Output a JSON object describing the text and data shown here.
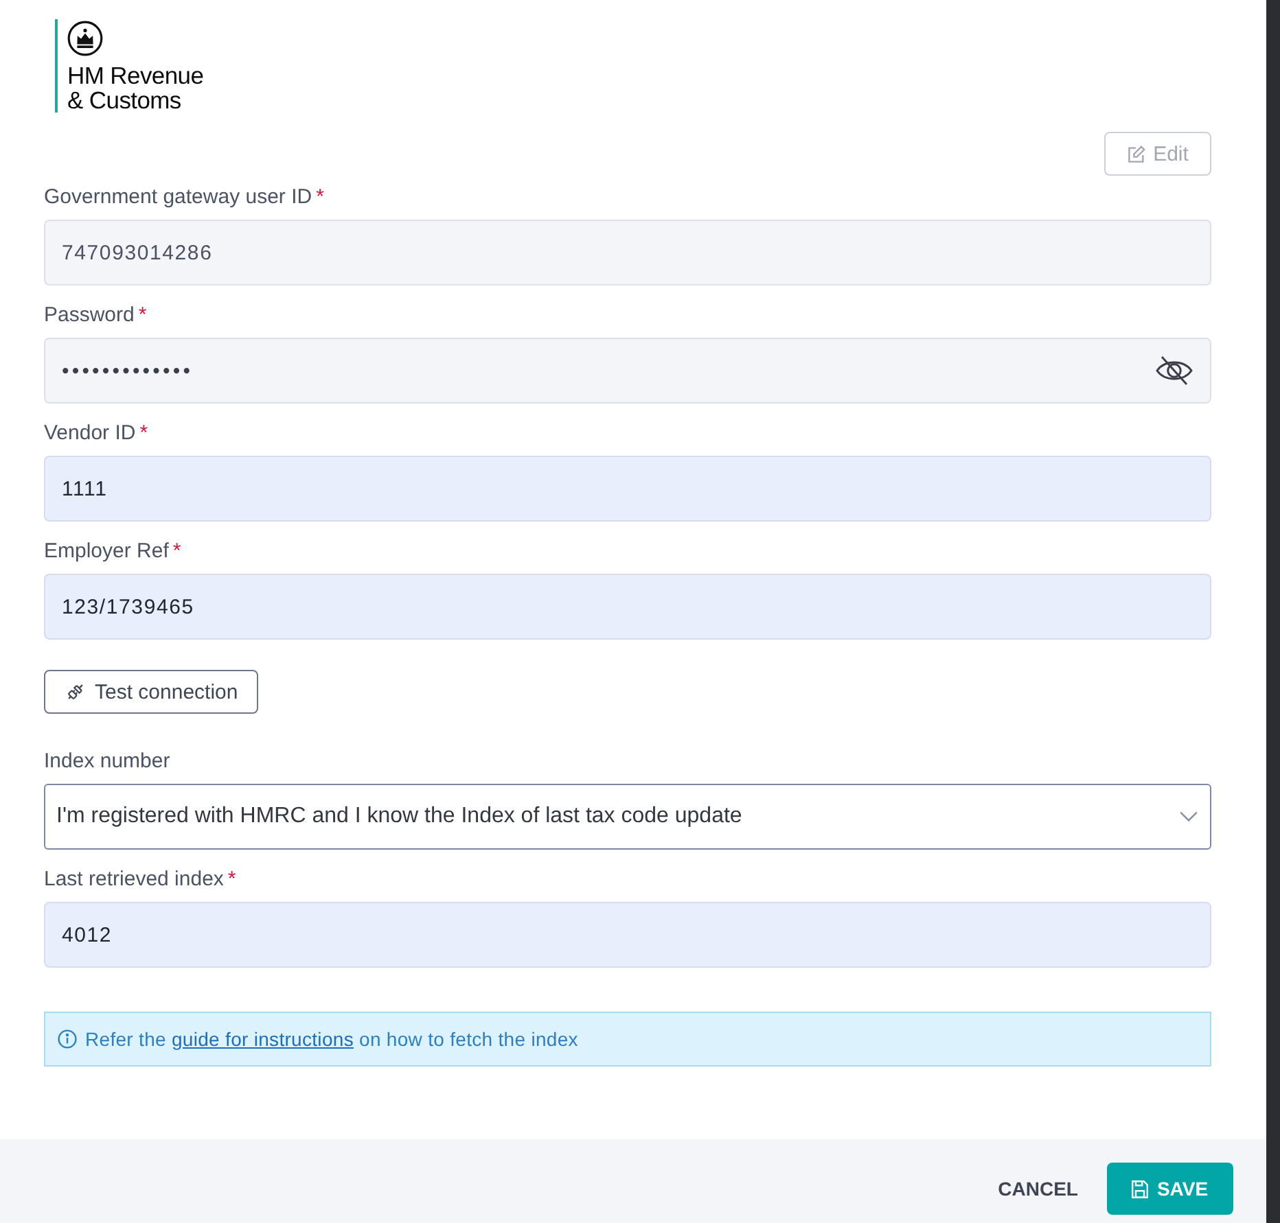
{
  "logo": {
    "lines": [
      "HM Revenue",
      "& Customs"
    ]
  },
  "edit_button": {
    "label": "Edit",
    "disabled": true
  },
  "items": [
    {
      "kind": "text",
      "label": "Government gateway user ID",
      "required_mark": "*",
      "value": "747093014286",
      "autofilled": false
    },
    {
      "kind": "password",
      "label": "Password",
      "required_mark": "*",
      "value": "•••••••••••••",
      "autofilled": false
    },
    {
      "kind": "text",
      "label": "Vendor ID",
      "required_mark": "*",
      "value": "1111",
      "autofilled": true
    },
    {
      "kind": "text",
      "label": "Employer Ref",
      "required_mark": "*",
      "value": "123/1739465",
      "autofilled": true
    },
    {
      "kind": "button",
      "label": "Test connection"
    },
    {
      "kind": "select",
      "label": "Index number",
      "value": "I'm registered with HMRC and I know the Index of last tax code update"
    },
    {
      "kind": "text",
      "label": "Last retrieved index",
      "required_mark": "*",
      "value": "4012",
      "autofilled": true
    }
  ],
  "info_alert": {
    "text_before": "Refer the",
    "link": "guide for instructions",
    "text_after": "on how to fetch the index"
  },
  "footer": {
    "cancel": "CANCEL",
    "save": "SAVE"
  }
}
